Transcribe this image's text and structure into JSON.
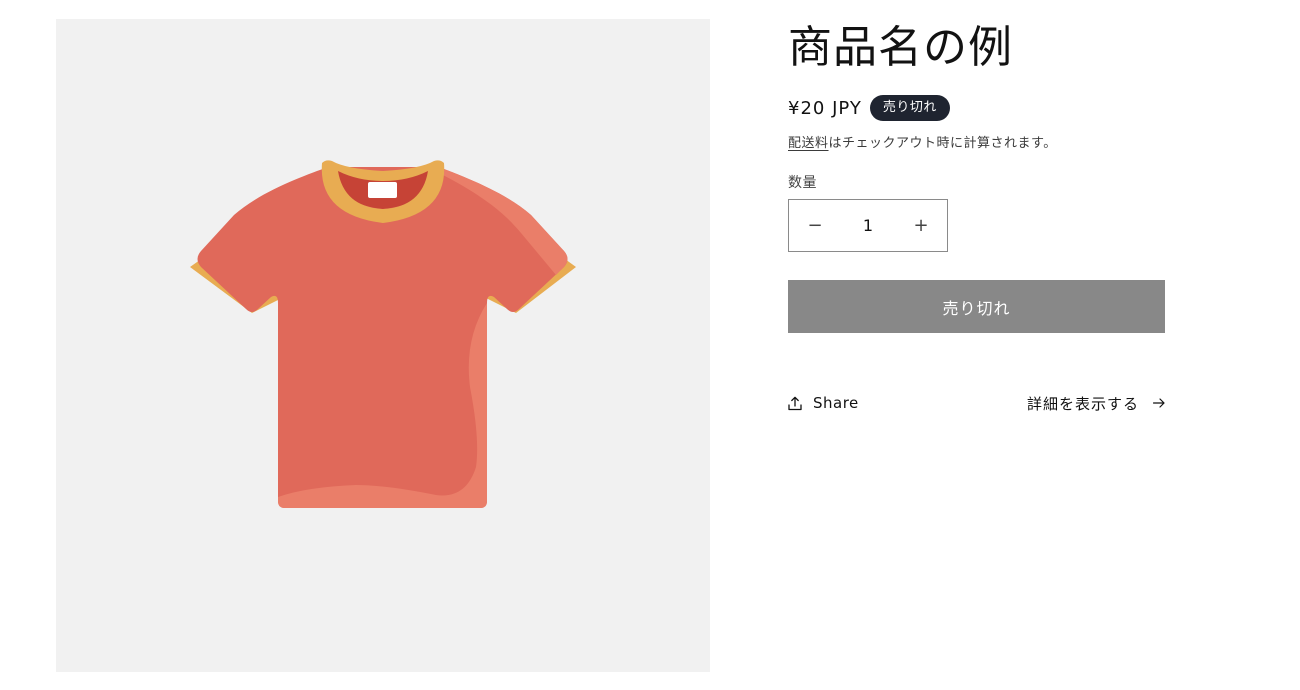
{
  "product": {
    "title": "商品名の例",
    "price": "¥20 JPY",
    "badge": "売り切れ",
    "shipping_link": "配送料",
    "shipping_text": "はチェックアウト時に計算されます。",
    "quantity_label": "数量",
    "quantity_value": "1",
    "decrease_symbol": "−",
    "increase_symbol": "+",
    "soldout_button": "売り切れ",
    "share_label": "Share",
    "details_link": "詳細を表示する"
  },
  "media": {
    "image_icon": "tshirt-icon"
  },
  "colors": {
    "media_bg": "#f1f1f1",
    "shirt_body": "#e0695a",
    "shirt_trim": "#e8ac52",
    "badge_bg": "#1f2430",
    "button_bg": "#888888"
  }
}
